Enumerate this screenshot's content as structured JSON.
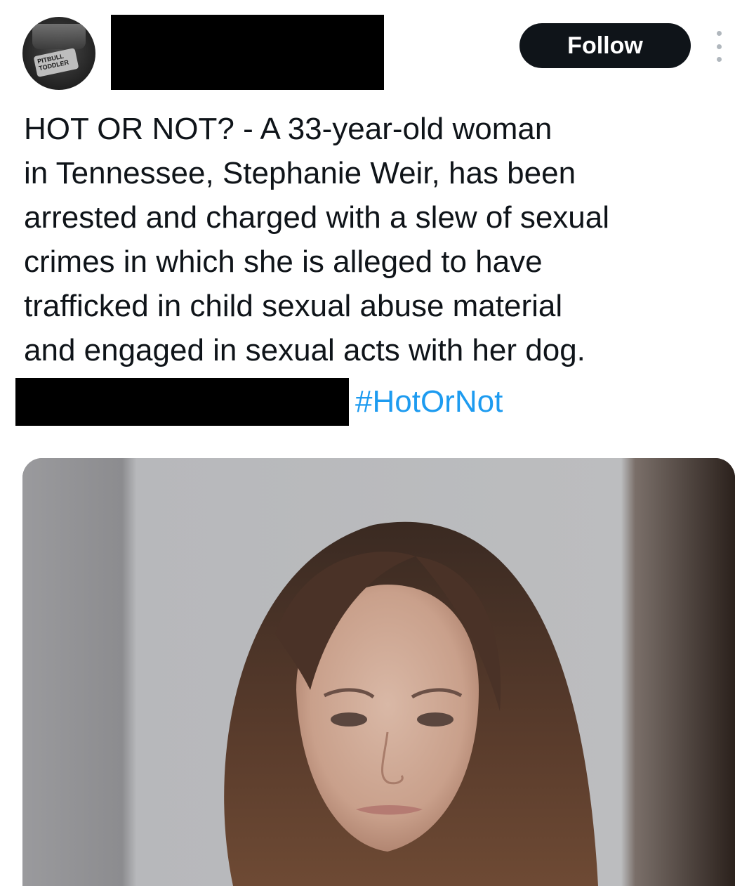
{
  "header": {
    "avatar_logo_text": "PITBULL\nTODDLER",
    "follow_label": "Follow"
  },
  "tweet": {
    "lines": [
      "HOT OR NOT? - A 33-year-old woman",
      "in Tennessee, Stephanie Weir, has been",
      "arrested and charged with a slew of sexual",
      "crimes in which she is alleged to have",
      "trafficked in child sexual abuse material",
      "and engaged in sexual acts with her dog."
    ],
    "hashtag": "#HotOrNot"
  },
  "colors": {
    "text": "#0f1419",
    "follow_bg": "#0f1419",
    "hashtag": "#1d9bf0",
    "redaction": "#000000"
  },
  "icons": {
    "more": "more-vertical-icon"
  }
}
